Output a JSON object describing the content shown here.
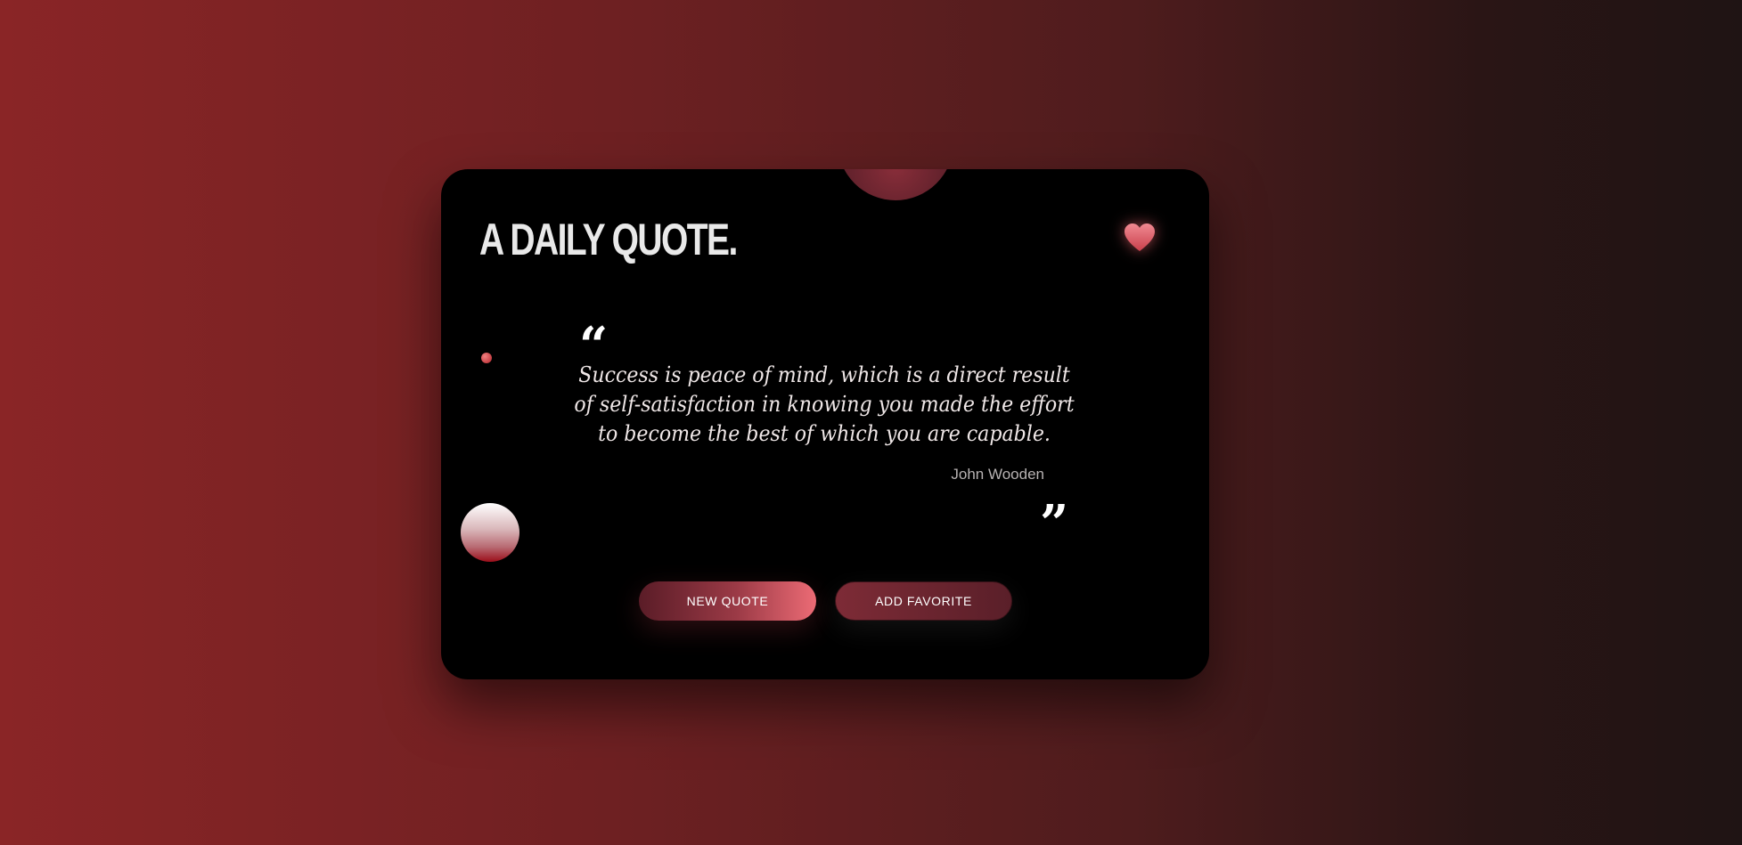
{
  "card": {
    "title": "A DAILY QUOTE.",
    "favorite_icon": "heart-icon"
  },
  "quote": {
    "open_mark": "“",
    "text": "Success is peace of mind, which is a direct result of self-satisfaction in knowing you made the effort to become the best of which you are capable.",
    "author": "John Wooden",
    "close_mark": "”"
  },
  "actions": {
    "new_quote_label": "NEW QUOTE",
    "add_favorite_label": "ADD FAVORITE"
  },
  "colors": {
    "accent": "#ec6b75",
    "card_background": "#000000",
    "heart": "#e0606b"
  }
}
